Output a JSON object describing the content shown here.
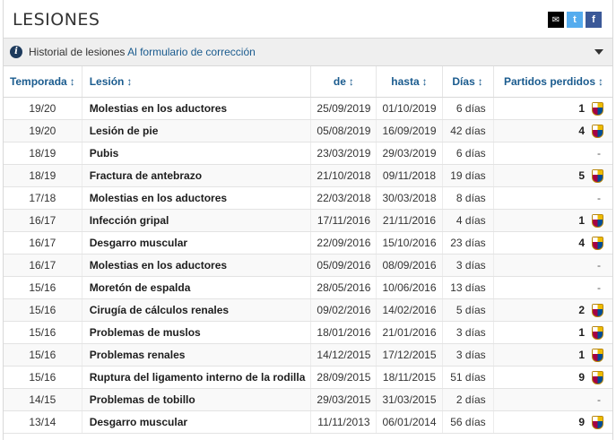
{
  "header": {
    "title": "LESIONES"
  },
  "share": {
    "mail_glyph": "✉",
    "twitter_glyph": "t",
    "facebook_glyph": "f"
  },
  "infobar": {
    "text": "Historial de lesiones",
    "link": "Al formulario de corrección"
  },
  "table": {
    "columns": [
      "Temporada",
      "Lesión",
      "de",
      "hasta",
      "Días",
      "Partidos perdidos"
    ],
    "sort_glyph": "↕",
    "rows": [
      {
        "season": "19/20",
        "injury": "Molestias en los aductores",
        "from": "25/09/2019",
        "until": "01/10/2019",
        "days": "6 días",
        "games": "1",
        "club": "barcelona-crest"
      },
      {
        "season": "19/20",
        "injury": "Lesión de pie",
        "from": "05/08/2019",
        "until": "16/09/2019",
        "days": "42 días",
        "games": "4",
        "club": "barcelona-crest"
      },
      {
        "season": "18/19",
        "injury": "Pubis",
        "from": "23/03/2019",
        "until": "29/03/2019",
        "days": "6 días",
        "games": "-",
        "club": ""
      },
      {
        "season": "18/19",
        "injury": "Fractura de antebrazo",
        "from": "21/10/2018",
        "until": "09/11/2018",
        "days": "19 días",
        "games": "5",
        "club": "barcelona-crest"
      },
      {
        "season": "17/18",
        "injury": "Molestias en los aductores",
        "from": "22/03/2018",
        "until": "30/03/2018",
        "days": "8 días",
        "games": "-",
        "club": ""
      },
      {
        "season": "16/17",
        "injury": "Infección gripal",
        "from": "17/11/2016",
        "until": "21/11/2016",
        "days": "4 días",
        "games": "1",
        "club": "barcelona-crest"
      },
      {
        "season": "16/17",
        "injury": "Desgarro muscular",
        "from": "22/09/2016",
        "until": "15/10/2016",
        "days": "23 días",
        "games": "4",
        "club": "barcelona-crest"
      },
      {
        "season": "16/17",
        "injury": "Molestias en los aductores",
        "from": "05/09/2016",
        "until": "08/09/2016",
        "days": "3 días",
        "games": "-",
        "club": ""
      },
      {
        "season": "15/16",
        "injury": "Moretón de espalda",
        "from": "28/05/2016",
        "until": "10/06/2016",
        "days": "13 días",
        "games": "-",
        "club": ""
      },
      {
        "season": "15/16",
        "injury": "Cirugía de cálculos renales",
        "from": "09/02/2016",
        "until": "14/02/2016",
        "days": "5 días",
        "games": "2",
        "club": "barcelona-crest"
      },
      {
        "season": "15/16",
        "injury": "Problemas de muslos",
        "from": "18/01/2016",
        "until": "21/01/2016",
        "days": "3 días",
        "games": "1",
        "club": "barcelona-crest"
      },
      {
        "season": "15/16",
        "injury": "Problemas renales",
        "from": "14/12/2015",
        "until": "17/12/2015",
        "days": "3 días",
        "games": "1",
        "club": "barcelona-crest"
      },
      {
        "season": "15/16",
        "injury": "Ruptura del ligamento interno de la rodilla",
        "from": "28/09/2015",
        "until": "18/11/2015",
        "days": "51 días",
        "games": "9",
        "club": "barcelona-crest"
      },
      {
        "season": "14/15",
        "injury": "Problemas de tobillo",
        "from": "29/03/2015",
        "until": "31/03/2015",
        "days": "2 días",
        "games": "-",
        "club": ""
      },
      {
        "season": "13/14",
        "injury": "Desgarro muscular",
        "from": "11/11/2013",
        "until": "06/01/2014",
        "days": "56 días",
        "games": "9",
        "club": "barcelona-crest"
      }
    ]
  }
}
